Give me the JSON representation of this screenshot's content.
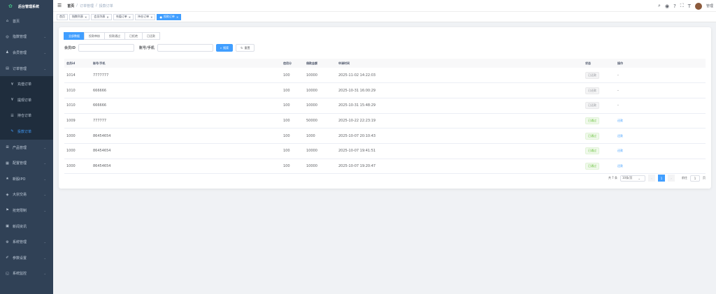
{
  "sidebar": {
    "title": "后台管理系统",
    "items": [
      {
        "label": "首页",
        "icon": "home-icon",
        "glyph": "⌂"
      },
      {
        "label": "指数管理",
        "icon": "target-icon",
        "glyph": "◎"
      },
      {
        "label": "会员管理",
        "icon": "user-icon",
        "glyph": "♟"
      },
      {
        "label": "订单管理",
        "icon": "document-icon",
        "glyph": "▤"
      },
      {
        "label": "充值订单",
        "icon": "yen-icon",
        "glyph": "¥",
        "sub": true
      },
      {
        "label": "提现订单",
        "icon": "yen-icon",
        "glyph": "¥",
        "sub": true
      },
      {
        "label": "持仓订单",
        "icon": "list-icon",
        "glyph": "☰",
        "sub": true
      },
      {
        "label": "投款订单",
        "icon": "edit-icon",
        "glyph": "✎",
        "sub": true,
        "active": true
      },
      {
        "label": "产品管理",
        "icon": "cart-icon",
        "glyph": "⊞"
      },
      {
        "label": "配置管理",
        "icon": "grid-icon",
        "glyph": "▦"
      },
      {
        "label": "新股IPO",
        "icon": "star-icon",
        "glyph": "★"
      },
      {
        "label": "大宗交易",
        "icon": "chart-icon",
        "glyph": "◈"
      },
      {
        "label": "抢宠限制",
        "icon": "flag-icon",
        "glyph": "⚑"
      },
      {
        "label": "新闻资讯",
        "icon": "news-icon",
        "glyph": "▣"
      },
      {
        "label": "系统管理",
        "icon": "gear-icon",
        "glyph": "⚙"
      },
      {
        "label": "参数设置",
        "icon": "settings-icon",
        "glyph": "✐"
      },
      {
        "label": "系统监控",
        "icon": "monitor-icon",
        "glyph": "◱"
      }
    ]
  },
  "breadcrumb": [
    "首页",
    "订单管理",
    "投款订单"
  ],
  "tags": [
    {
      "label": "首页"
    },
    {
      "label": "指数列表"
    },
    {
      "label": "会员列表"
    },
    {
      "label": "充值订单"
    },
    {
      "label": "持仓订单"
    },
    {
      "label": "投款订单",
      "active": true
    }
  ],
  "user": "管理",
  "status_tabs": [
    {
      "label": "全部数据",
      "active": true
    },
    {
      "label": "投款审核"
    },
    {
      "label": "投款通过"
    },
    {
      "label": "已拒绝"
    },
    {
      "label": "已还款"
    }
  ],
  "filters": {
    "member_id_label": "会员ID",
    "account_label": "账号/手机",
    "search_label": "搜索",
    "reset_label": "重置"
  },
  "table": {
    "headers": [
      "会员id",
      "账号/手机",
      "信用分",
      "借款金额",
      "申请时间",
      "状态",
      "操作"
    ],
    "rows": [
      [
        "1014",
        "7777777",
        "100",
        "10000",
        "2025-11-02 14:22:03",
        "已还款",
        "-"
      ],
      [
        "1010",
        "666666",
        "100",
        "10000",
        "2025-10-31 16:00:29",
        "已还款",
        "-"
      ],
      [
        "1010",
        "666666",
        "100",
        "10000",
        "2025-10-31 15:48:29",
        "已还款",
        "-"
      ],
      [
        "1009",
        "777777",
        "100",
        "50000",
        "2025-10-22 22:23:19",
        "已通过",
        "还款"
      ],
      [
        "1000",
        "86454654",
        "100",
        "1000",
        "2025-10-07 20:10:43",
        "已通过",
        "还款"
      ],
      [
        "1000",
        "86454654",
        "100",
        "10000",
        "2025-10-07 19:41:51",
        "已通过",
        "还款"
      ],
      [
        "1000",
        "86454654",
        "100",
        "10000",
        "2025-10-07 19:20:47",
        "已通过",
        "还款"
      ]
    ]
  },
  "pagination": {
    "total": "共 7 条",
    "page_size": "10条/页",
    "current": "1",
    "goto_label": "前往",
    "goto_value": "1",
    "page_suffix": "页"
  },
  "colors": {
    "primary": "#409eff",
    "sidebar": "#304156",
    "success": "#67c23a"
  }
}
